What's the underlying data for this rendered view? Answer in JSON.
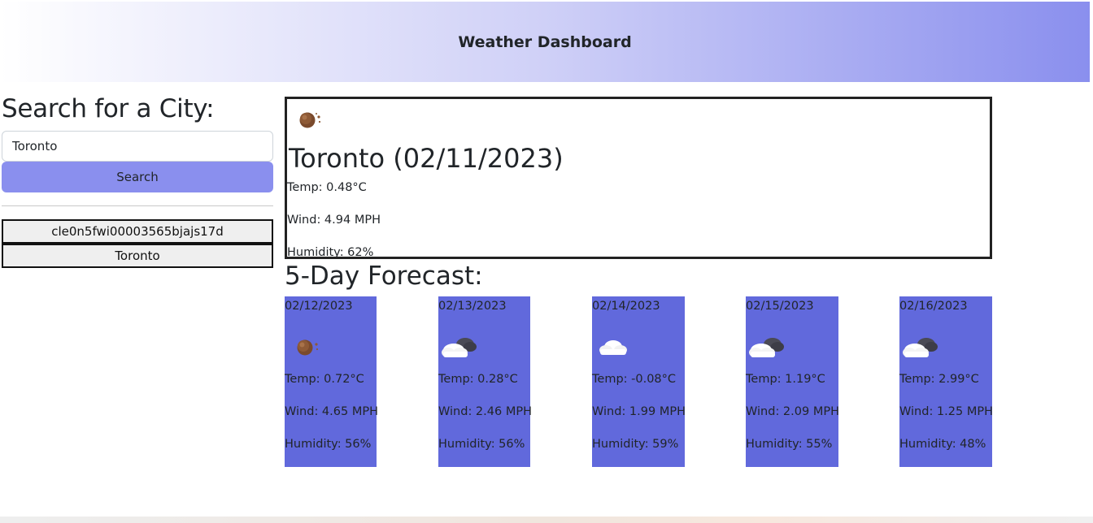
{
  "header": {
    "title": "Weather Dashboard"
  },
  "search": {
    "heading": "Search for a City:",
    "input_value": "Toronto",
    "button_label": "Search"
  },
  "history": [
    {
      "label": "cle0n5fwi00003565bjajs17d"
    },
    {
      "label": "Toronto"
    }
  ],
  "current": {
    "icon": "night-clear-icon",
    "title": "Toronto (02/11/2023)",
    "temp": "Temp: 0.48°C",
    "wind": "Wind: 4.94 MPH",
    "humidity": "Humidity: 62%"
  },
  "forecast": {
    "heading": "5-Day Forecast:",
    "days": [
      {
        "date": "02/12/2023",
        "icon": "night-clear-icon",
        "temp": "Temp: 0.72°C",
        "wind": "Wind: 4.65 MPH",
        "humidity": "Humidity: 56%"
      },
      {
        "date": "02/13/2023",
        "icon": "broken-clouds-icon",
        "temp": "Temp: 0.28°C",
        "wind": "Wind: 2.46 MPH",
        "humidity": "Humidity: 56%"
      },
      {
        "date": "02/14/2023",
        "icon": "cloud-icon",
        "temp": "Temp: -0.08°C",
        "wind": "Wind: 1.99 MPH",
        "humidity": "Humidity: 59%"
      },
      {
        "date": "02/15/2023",
        "icon": "broken-clouds-icon",
        "temp": "Temp: 1.19°C",
        "wind": "Wind: 2.09 MPH",
        "humidity": "Humidity: 55%"
      },
      {
        "date": "02/16/2023",
        "icon": "broken-clouds-icon",
        "temp": "Temp: 2.99°C",
        "wind": "Wind: 1.25 MPH",
        "humidity": "Humidity: 48%"
      }
    ]
  },
  "colors": {
    "header_gradient_end": "#8a8fee",
    "search_button": "#8a8fee",
    "forecast_card": "#6169dc"
  }
}
